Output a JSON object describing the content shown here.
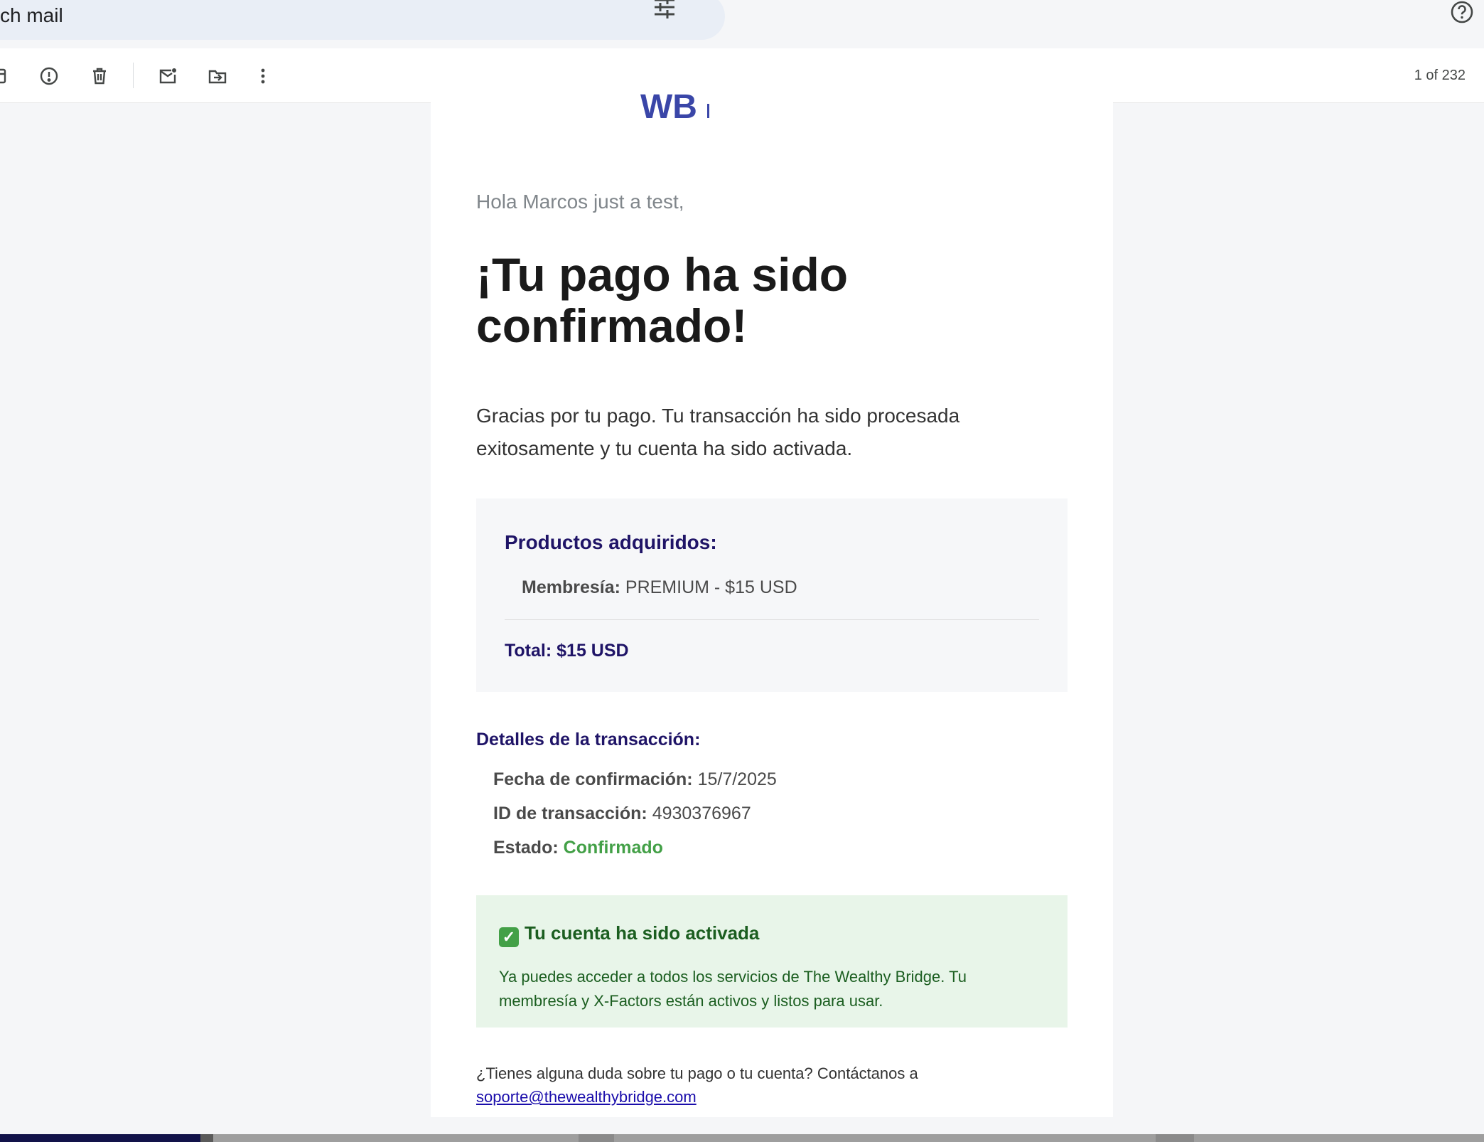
{
  "search": {
    "text": "ch mail"
  },
  "toolbar": {
    "counter": "1 of 232"
  },
  "email": {
    "logo_text": "WB",
    "greeting": "Hola Marcos just a test,",
    "headline": "¡Tu pago ha sido confirmado!",
    "intro": "Gracias por tu pago. Tu transacción ha sido procesada exitosamente y tu cuenta ha sido activada.",
    "products": {
      "heading": "Productos adquiridos:",
      "item_label": "Membresía:",
      "item_value": "PREMIUM - $15 USD",
      "total": "Total: $15 USD"
    },
    "details": {
      "heading": "Detalles de la transacción:",
      "date_label": "Fecha de confirmación:",
      "date_value": "15/7/2025",
      "id_label": "ID de transacción:",
      "id_value": "4930376967",
      "status_label": "Estado:",
      "status_value": "Confirmado"
    },
    "activation": {
      "check_glyph": "✓",
      "title": "Tu cuenta ha sido activada",
      "body": "Ya puedes acceder a todos los servicios de The Wealthy Bridge. Tu membresía y X-Factors están activos y listos para usar."
    },
    "footer": {
      "question": "¿Tienes alguna duda sobre tu pago o tu cuenta? Contáctanos a",
      "email": "soporte@thewealthybridge.com"
    }
  },
  "colors": {
    "heading_navy": "#1f1467",
    "status_green": "#43a047",
    "success_bg": "#e8f5e9",
    "link_blue": "#1a0dab"
  }
}
